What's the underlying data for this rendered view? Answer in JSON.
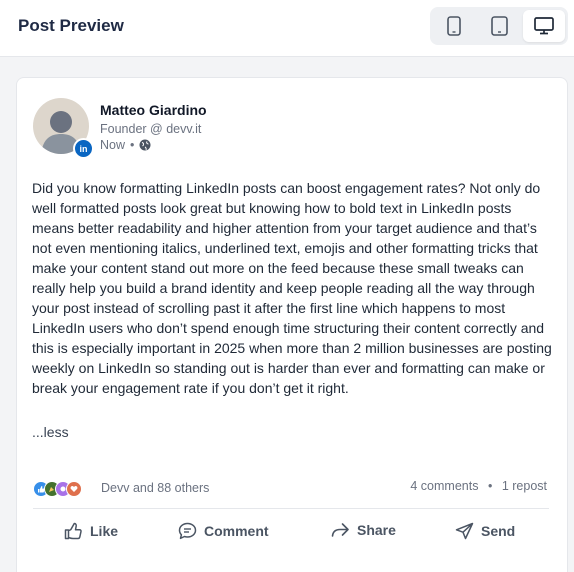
{
  "header": {
    "title": "Post Preview",
    "devices": [
      {
        "name": "mobile",
        "icon": "mobile-icon",
        "active": false
      },
      {
        "name": "tablet",
        "icon": "tablet-icon",
        "active": false
      },
      {
        "name": "desktop",
        "icon": "desktop-icon",
        "active": true
      }
    ]
  },
  "post": {
    "author": {
      "name": "Matteo Giardino",
      "role": "Founder @ devv.it",
      "badge": "in"
    },
    "time": "Now",
    "visibility_icon": "globe-icon",
    "body": "Did you know formatting LinkedIn posts can boost engagement rates? Not only do well formatted posts look great but knowing how to bold text in LinkedIn posts means better readability and higher attention from your target audience and that’s not even mentioning italics, underlined text, emojis and other formatting tricks that make your content stand out more on the feed because these small tweaks can really help you build a brand identity and keep people reading all the way through your post instead of scrolling past it after the first line which happens to most LinkedIn users who don’t spend enough time structuring their content correctly and this is especially important in 2025 when more than 2 million businesses are posting weekly on LinkedIn so standing out is harder than ever and formatting can make or break your engagement rate if you don’t get it right.",
    "see_less": "...less",
    "reactions": {
      "icons": [
        "like-reaction-icon",
        "celebrate-reaction-icon",
        "support-reaction-icon",
        "love-reaction-icon"
      ],
      "text": "Devv and 88 others"
    },
    "comments": "4 comments",
    "separator": "•",
    "reposts": "1 repost",
    "actions": [
      {
        "label": "Like",
        "icon": "thumbs-up-icon"
      },
      {
        "label": "Comment",
        "icon": "comment-icon"
      },
      {
        "label": "Share",
        "icon": "share-arrow-icon"
      },
      {
        "label": "Send",
        "icon": "send-icon"
      }
    ]
  },
  "colors": {
    "linkedin_blue": "#0a66c2",
    "title": "#1f2a44",
    "muted": "#6b7280"
  }
}
